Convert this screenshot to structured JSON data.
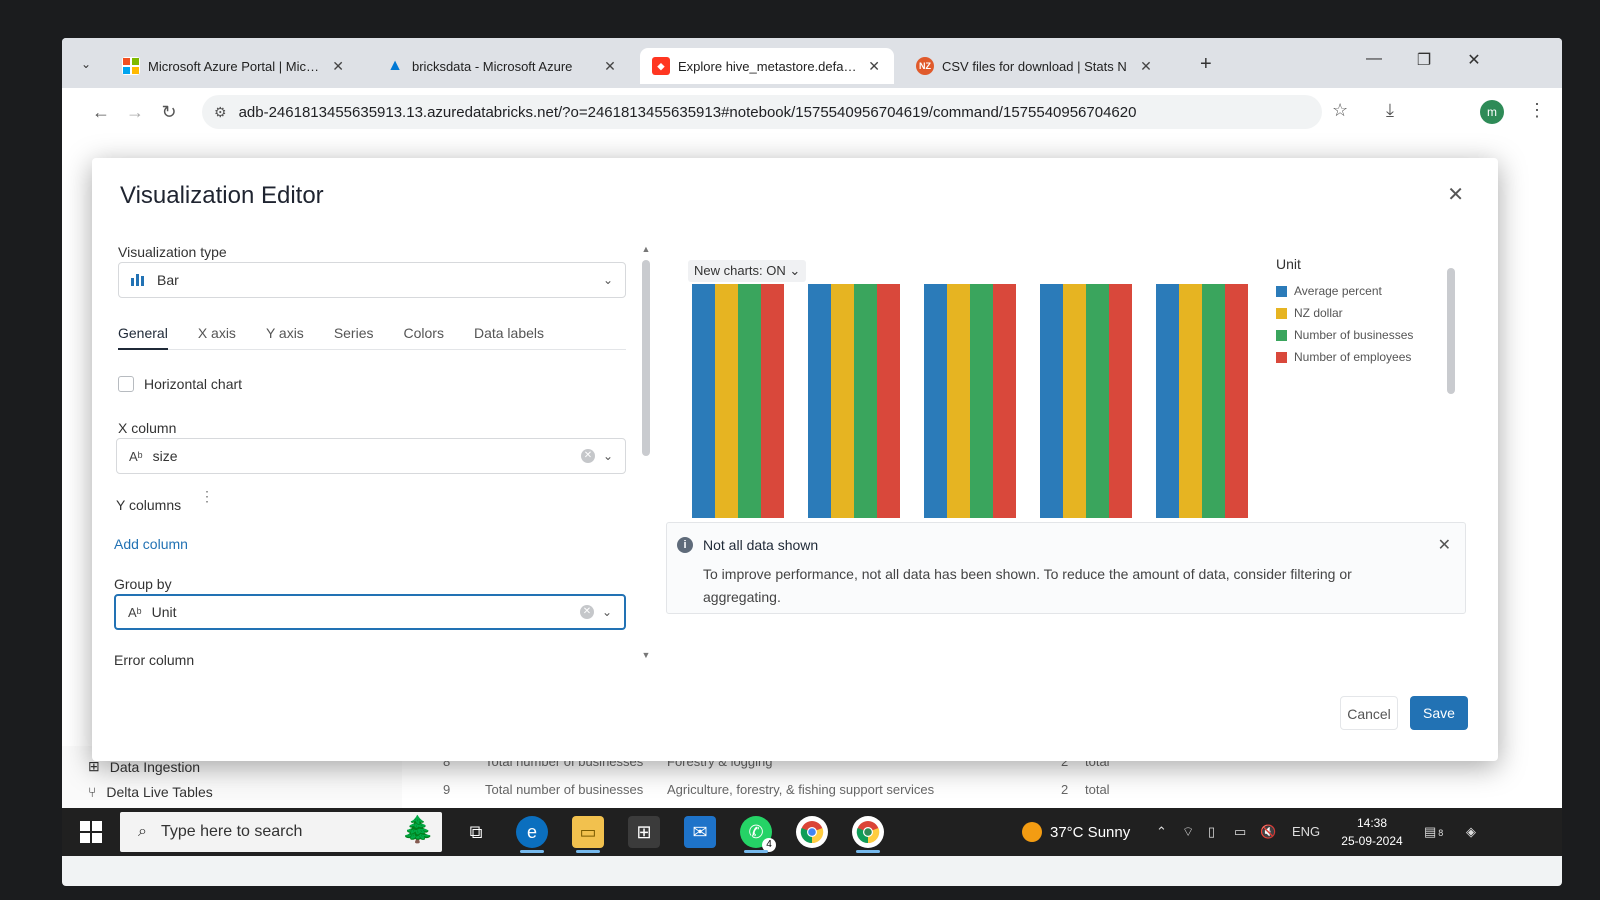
{
  "browser": {
    "tabs": [
      {
        "title": "Microsoft Azure Portal | Micros",
        "favicon": "microsoft-logo-icon",
        "color": "#f25022"
      },
      {
        "title": "bricksdata - Microsoft Azure",
        "favicon": "azure-logo-icon",
        "color": "#0078d4"
      },
      {
        "title": "Explore hive_metastore.default.",
        "favicon": "databricks-logo-icon",
        "color": "#ff3621"
      },
      {
        "title": "CSV files for download | Stats N",
        "favicon": "stats-nz-icon",
        "color": "#e05a2b"
      }
    ],
    "url": "adb-2461813455635913.13.azuredatabricks.net/?o=2461813455635913#notebook/1575540956704619/command/1575540956704620",
    "profile_initial": "m"
  },
  "modal": {
    "title": "Visualization Editor",
    "viz_type_label": "Visualization type",
    "viz_type_value": "Bar",
    "tabs": [
      "General",
      "X axis",
      "Y axis",
      "Series",
      "Colors",
      "Data labels"
    ],
    "active_tab": "General",
    "horizontal_chart_label": "Horizontal chart",
    "x_column_label": "X column",
    "x_column_value": "size",
    "y_columns_label": "Y columns",
    "add_column_label": "Add column",
    "group_by_label": "Group by",
    "group_by_value": "Unit",
    "error_column_label": "Error column",
    "new_charts_label": "New charts: ON",
    "legend_title": "Unit",
    "notice_title": "Not all data shown",
    "notice_body": "To improve performance, not all data has been shown. To reduce the amount of data, consider filtering or aggregating.",
    "cancel_label": "Cancel",
    "save_label": "Save"
  },
  "chart_data": {
    "type": "bar",
    "categories": [
      "",
      "",
      "",
      "",
      ""
    ],
    "series": [
      {
        "name": "Average percent",
        "color": "#2b7bb9",
        "values": [
          1,
          1,
          1,
          1,
          1
        ]
      },
      {
        "name": "NZ dollar",
        "color": "#e6b422",
        "values": [
          1,
          1,
          1,
          1,
          1
        ]
      },
      {
        "name": "Number of businesses",
        "color": "#3aa55d",
        "values": [
          1,
          1,
          1,
          1,
          1
        ]
      },
      {
        "name": "Number of employees",
        "color": "#d9483b",
        "values": [
          1,
          1,
          1,
          1,
          1
        ]
      }
    ],
    "grid": false,
    "legend_position": "right"
  },
  "background": {
    "sidebar_items": [
      "Data Ingestion",
      "Delta Live Tables"
    ],
    "rows": [
      {
        "num": "8",
        "measure": "Total number of businesses",
        "industry": "Forestry & logging",
        "count": "2",
        "kind": "total"
      },
      {
        "num": "9",
        "measure": "Total number of businesses",
        "industry": "Agriculture, forestry, & fishing support services",
        "count": "2",
        "kind": "total"
      }
    ]
  },
  "taskbar": {
    "search_placeholder": "Type here to search",
    "weather": "37°C  Sunny",
    "language": "ENG",
    "time": "14:38",
    "date": "25-09-2024",
    "whatsapp_badge": "4",
    "notifications_badge": "8"
  }
}
